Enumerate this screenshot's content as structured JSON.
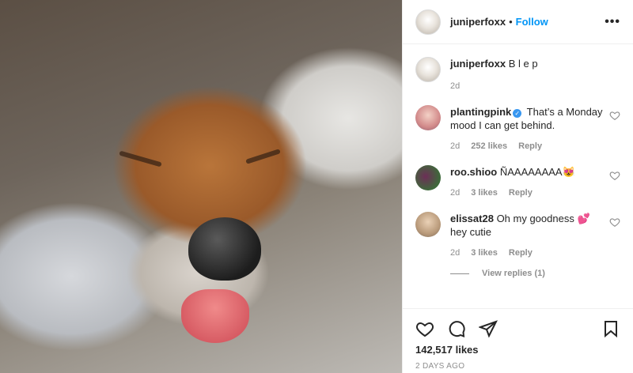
{
  "post": {
    "username": "juniperfoxx",
    "dot": "•",
    "follow_label": "Follow",
    "more_label": "•••",
    "caption": "B l e p",
    "caption_age": "2d",
    "likes": "142,517 likes",
    "posted_ago": "2 DAYS AGO"
  },
  "comments": [
    {
      "username": "plantingpink",
      "verified": true,
      "text": "That’s a Monday mood I can get behind.",
      "age": "2d",
      "likes": "252 likes",
      "reply_label": "Reply"
    },
    {
      "username": "roo.shioo",
      "verified": false,
      "text": "ÑAAAAAAAA😻",
      "age": "2d",
      "likes": "3 likes",
      "reply_label": "Reply"
    },
    {
      "username": "elissat28",
      "verified": false,
      "text": "Oh my goodness 💕 hey cutie",
      "age": "2d",
      "likes": "3 likes",
      "reply_label": "Reply",
      "view_replies": "View replies (1)"
    }
  ],
  "icons": {
    "like": "heart-icon",
    "comment": "comment-icon",
    "share": "share-icon",
    "save": "bookmark-icon",
    "comment_like": "heart-icon"
  },
  "colors": {
    "link": "#0095f6",
    "muted": "#8e8e8e",
    "text": "#262626",
    "verified": "#3897f0"
  }
}
